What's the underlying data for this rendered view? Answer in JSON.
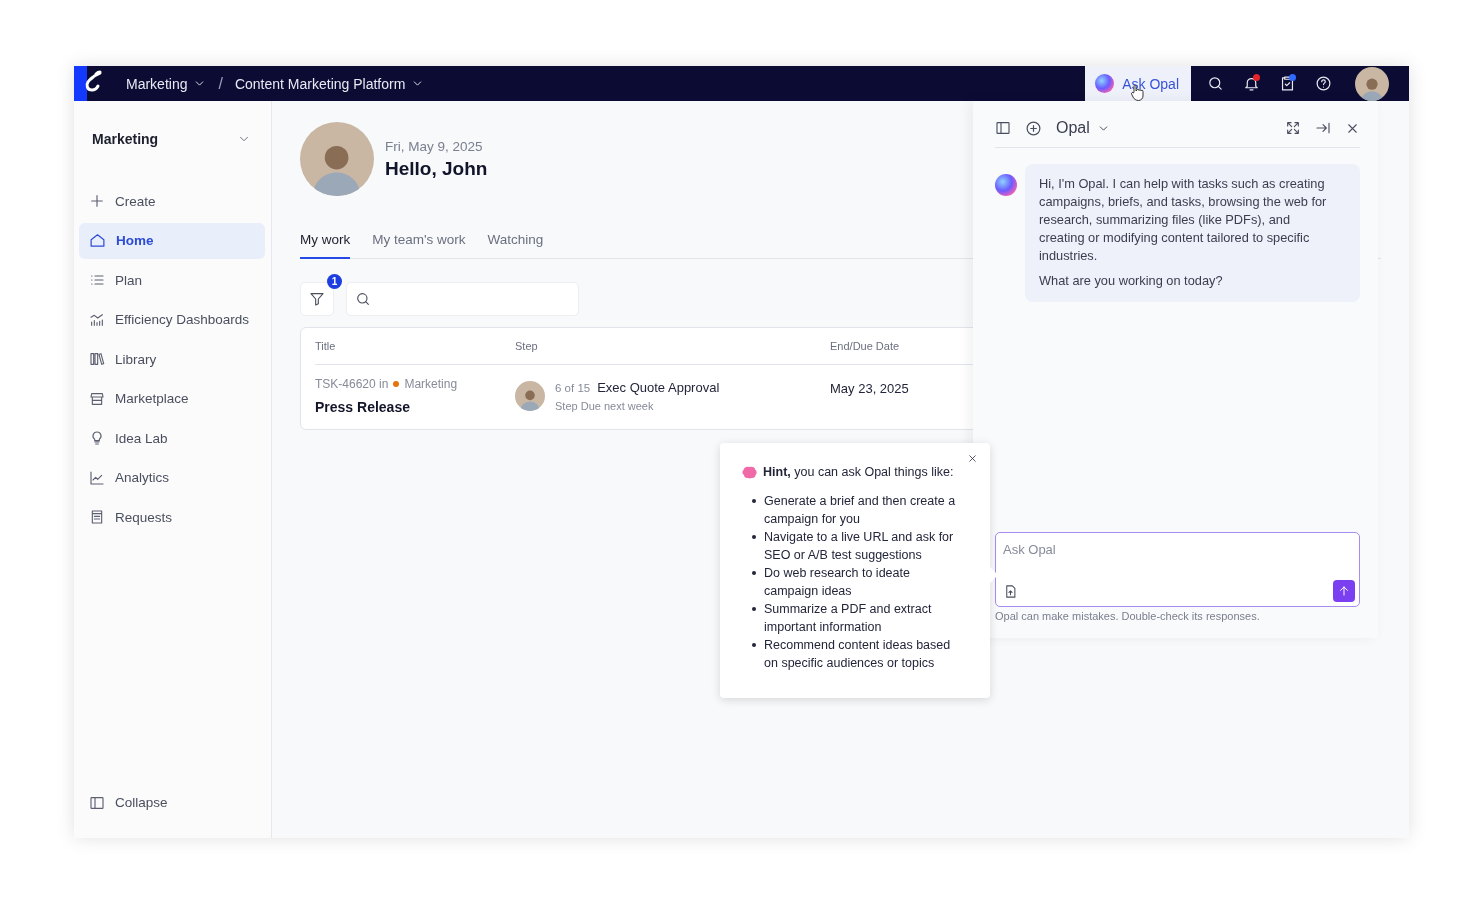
{
  "top_bar": {
    "breadcrumbs": [
      {
        "label": "Marketing"
      },
      {
        "label": "Content Marketing Platform"
      }
    ],
    "separator": "/",
    "ask_button": {
      "label": "Ask Opal",
      "selected": true
    },
    "notifications_unread": true,
    "tasks_unread": true
  },
  "sidebar": {
    "title": "Marketing",
    "items": [
      {
        "label": "Create",
        "selected": false
      },
      {
        "label": "Home",
        "selected": true
      },
      {
        "label": "Plan",
        "selected": false
      },
      {
        "label": "Efficiency Dashboards",
        "selected": false
      },
      {
        "label": "Library",
        "selected": false
      },
      {
        "label": "Marketplace",
        "selected": false
      },
      {
        "label": "Idea Lab",
        "selected": false
      },
      {
        "label": "Analytics",
        "selected": false
      },
      {
        "label": "Requests",
        "selected": false
      }
    ],
    "collapse": "Collapse"
  },
  "greeting": {
    "date": "Fri, May 9, 2025",
    "title": "Hello, John"
  },
  "tabs": [
    {
      "label": "My work",
      "selected": true
    },
    {
      "label": "My team's work",
      "selected": false
    },
    {
      "label": "Watching",
      "selected": false
    }
  ],
  "filter": {
    "badge": "1"
  },
  "table": {
    "columns": [
      "Title",
      "Step",
      "End/Due Date"
    ],
    "rows": [
      {
        "task": "TSK-46620 in",
        "project": "Marketing",
        "color": "#e8710a",
        "title": "Press Release",
        "step_count": "6 of 15",
        "step": "Exec Quote Approval",
        "step_due": "Step Due next week",
        "due_date": "May 23, 2025"
      }
    ]
  },
  "opal_panel": {
    "title": "Opal",
    "message": [
      "Hi, I'm Opal. I can help with tasks such as creating campaigns, briefs, and tasks, browsing the web for research, summarizing files (like PDFs), and creating or modifying content tailored to specific industries.",
      "What are you working on today?"
    ],
    "input": {
      "placeholder": "Ask Opal"
    },
    "disclaimer": "Opal can make mistakes. Double-check its responses."
  },
  "hint": {
    "text": "**Hint,** you can ask Opal things like:",
    "items": [
      "Generate a brief and then create a campaign for you",
      "Navigate to a live URL and ask for SEO or A/B test suggestions",
      "Do web research to ideate campaign ideas",
      "Summarize a PDF and extract important information",
      "Recommend content ideas based on specific audiences or topics"
    ]
  }
}
